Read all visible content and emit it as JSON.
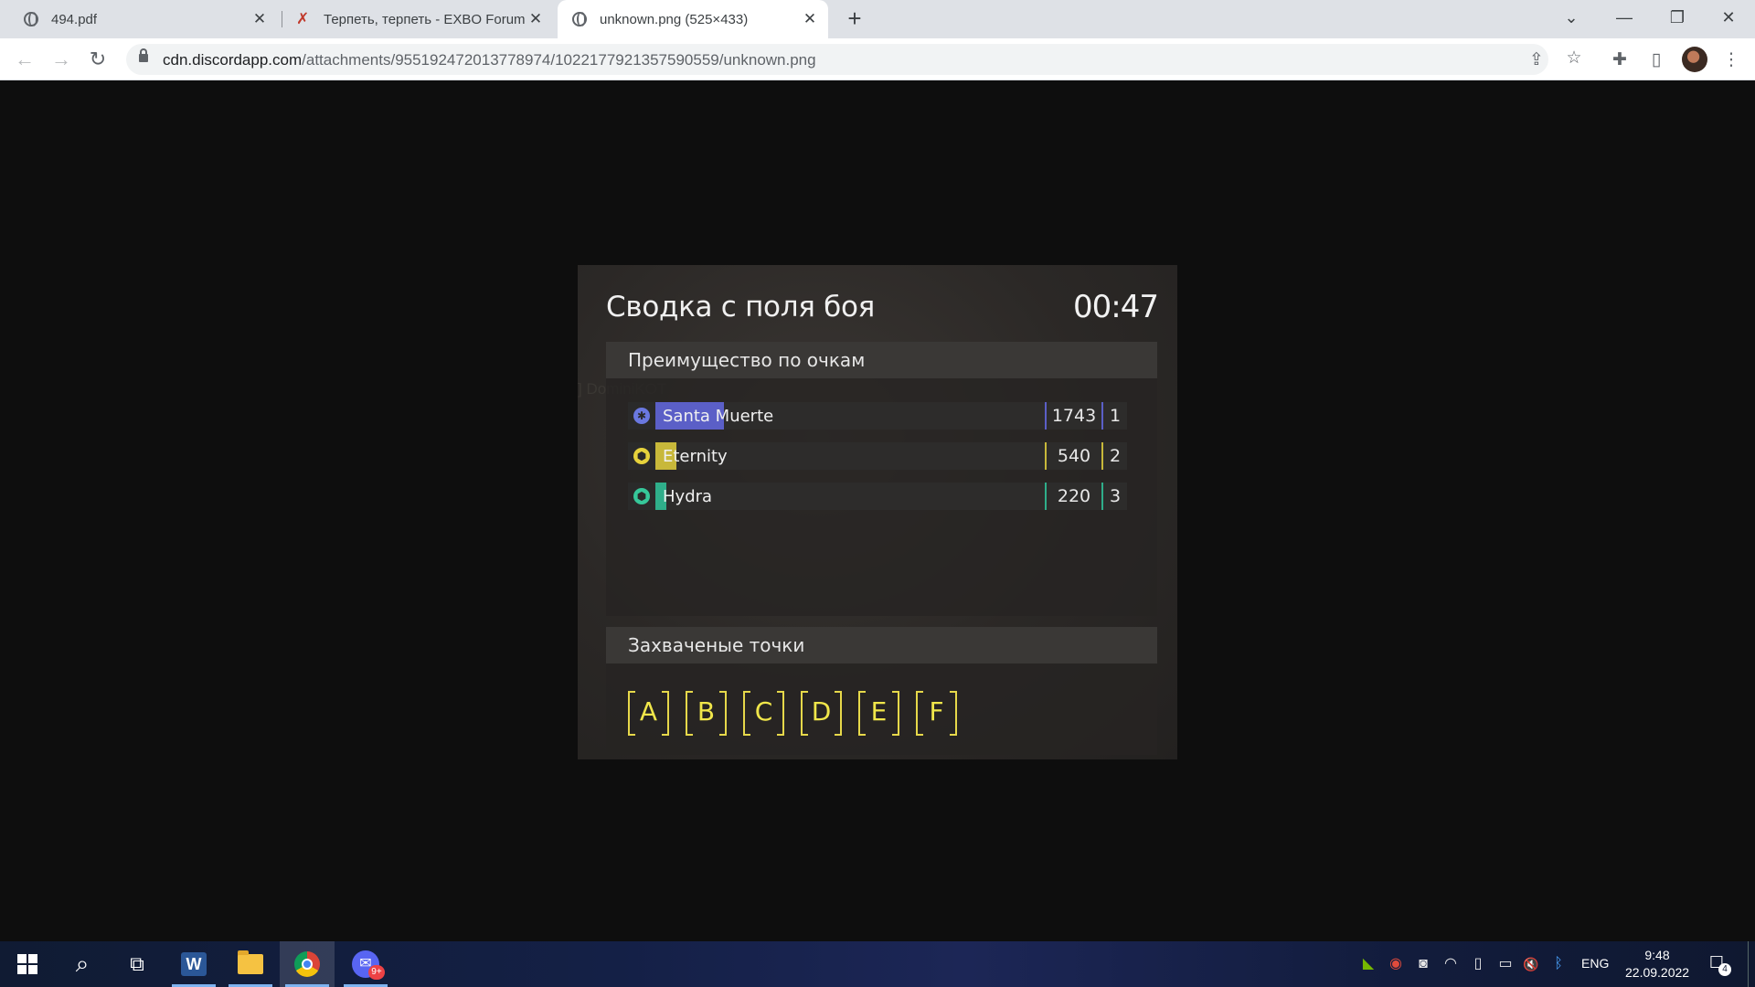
{
  "browser": {
    "tabs": [
      {
        "title": "494.pdf",
        "icon": "globe-icon",
        "active": false
      },
      {
        "title": "Терпеть, терпеть - EXBO Forum",
        "icon": "exbo-icon",
        "active": false
      },
      {
        "title": "unknown.png (525×433)",
        "icon": "globe-icon",
        "active": true
      }
    ],
    "close_glyph": "✕",
    "new_tab_glyph": "+",
    "window_controls": {
      "dropdown": "⌄",
      "minimize": "—",
      "restore": "❐",
      "close": "✕"
    },
    "nav": {
      "back": "←",
      "forward": "→",
      "reload": "↻"
    },
    "url": {
      "host": "cdn.discordapp.com",
      "path": "/attachments/955192472013778974/1022177921357590559/unknown.png"
    },
    "omnibox_icons": {
      "share": "⇪",
      "bookmark": "☆"
    },
    "toolbar_icons": {
      "extensions": "✚",
      "side_panel": "▯",
      "menu": "⋮"
    }
  },
  "game_panel": {
    "ghost_text": "] DominiKOT",
    "title": "Сводка с поля боя",
    "timer": "00:47",
    "score_section": {
      "header": "Преимущество по очкам",
      "teams": [
        {
          "name": "Santa Muerte",
          "score": "1743",
          "place": "1",
          "color": "#5b5fc7",
          "icon_color": "#6a78e0",
          "icon_glyph": "✱",
          "fill_fraction": 0.177
        },
        {
          "name": "Eternity",
          "score": "540",
          "place": "2",
          "color": "#c8b83a",
          "icon_color": "#e6d23c",
          "icon_glyph": "⬢",
          "fill_fraction": 0.055
        },
        {
          "name": "Hydra",
          "score": "220",
          "place": "3",
          "color": "#2fae8a",
          "icon_color": "#36c79a",
          "icon_glyph": "⬢",
          "fill_fraction": 0.023
        }
      ]
    },
    "points_section": {
      "header": "Захваченые точки",
      "points": [
        "A",
        "B",
        "C",
        "D",
        "E",
        "F"
      ],
      "color": "#f0e64a"
    }
  },
  "taskbar": {
    "apps": [
      {
        "name": "windows-start",
        "open": false
      },
      {
        "name": "search",
        "glyph": "⌕",
        "open": false
      },
      {
        "name": "task-view",
        "glyph": "⧉",
        "open": false
      },
      {
        "name": "word",
        "glyph": "W",
        "open": true
      },
      {
        "name": "file-explorer",
        "open": true
      },
      {
        "name": "chrome",
        "open": true,
        "active": true
      },
      {
        "name": "discord",
        "glyph": "✉",
        "badge": "9+",
        "open": true
      }
    ],
    "tray": {
      "icons": [
        "nvidia-icon",
        "steam-icon",
        "discord-tray-icon",
        "wifi-icon",
        "usb-icon",
        "battery-icon",
        "volume-muted-icon",
        "bluetooth-icon"
      ],
      "glyphs": [
        "◣",
        "◉",
        "◙",
        "◠",
        "▯",
        "▭",
        "🔇",
        "ᛒ"
      ],
      "language": "ENG",
      "time": "9:48",
      "date": "22.09.2022",
      "notifications": "4",
      "notif_glyph": "☐"
    }
  }
}
